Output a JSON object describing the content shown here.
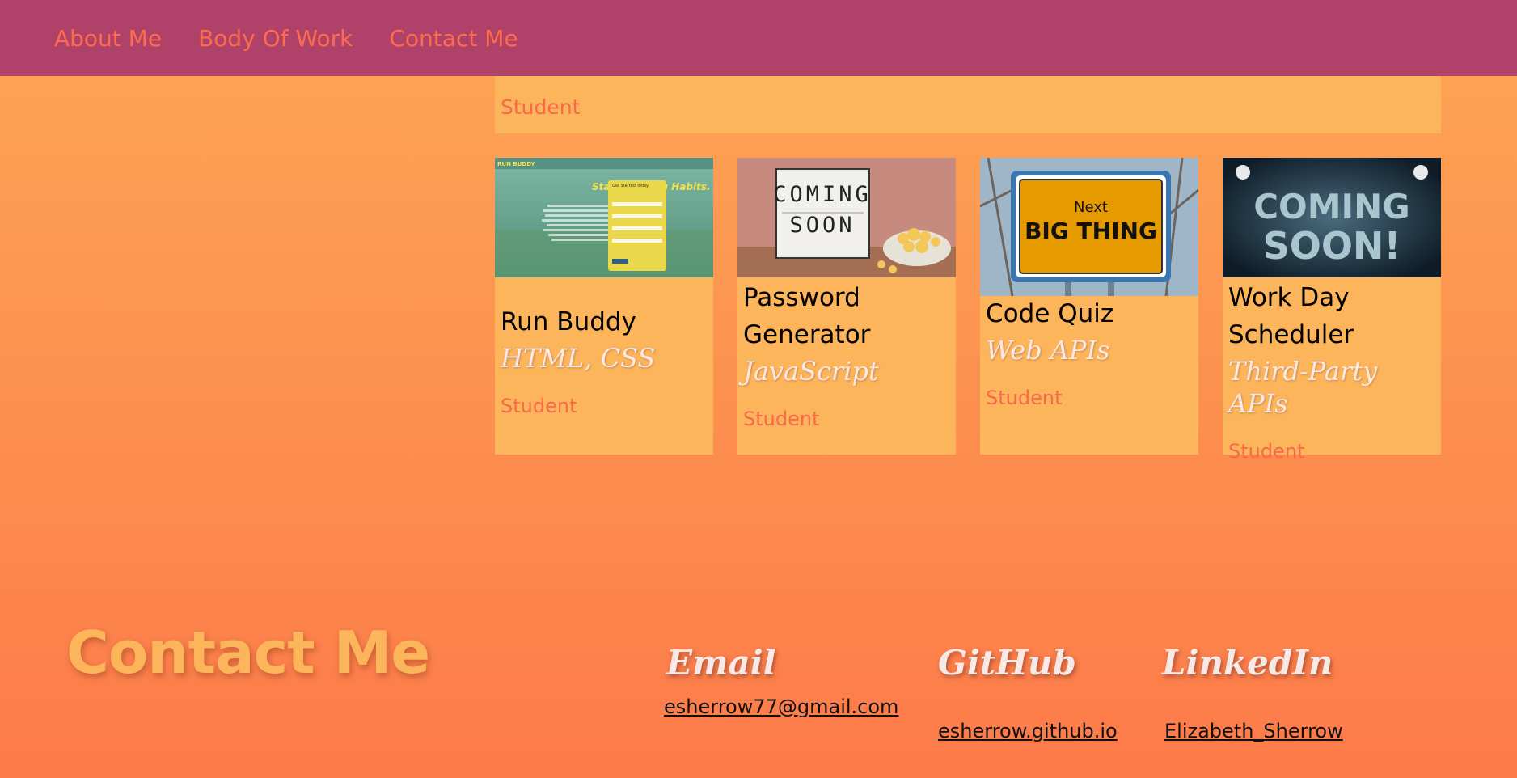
{
  "nav": {
    "items": [
      "About Me",
      "Body Of Work",
      "Contact Me"
    ]
  },
  "banner": {
    "label": "Student"
  },
  "projects": [
    {
      "title": "Run Buddy",
      "tech": "HTML, CSS",
      "role": "Student",
      "thumb": {
        "brand": "RUN BUDDY",
        "headline": "Start Building Habits.",
        "form_title": "Get Started Today"
      }
    },
    {
      "title": "Password Generator",
      "tech": "JavaScript",
      "role": "Student",
      "thumb": {
        "line1": "COMING",
        "line2": "SOON"
      }
    },
    {
      "title": "Code Quiz",
      "tech": "Web APIs",
      "role": "Student",
      "thumb": {
        "line1": "Next",
        "line2": "BIG THING"
      }
    },
    {
      "title": "Work Day Scheduler",
      "tech": "Third-Party APIs",
      "role": "Student",
      "thumb": {
        "line1": "COMING",
        "line2": "SOON!"
      }
    }
  ],
  "contact": {
    "title": "Contact Me",
    "email": {
      "heading": "Email",
      "value": "esherrow77@gmail.com"
    },
    "github": {
      "heading": "GitHub",
      "value": "esherrow.github.io"
    },
    "linkedin": {
      "heading": "LinkedIn",
      "value": "Elizabeth_Sherrow"
    }
  },
  "colors": {
    "header": "#b04269",
    "accent": "#fb6c4d",
    "card": "#fcb55a"
  }
}
